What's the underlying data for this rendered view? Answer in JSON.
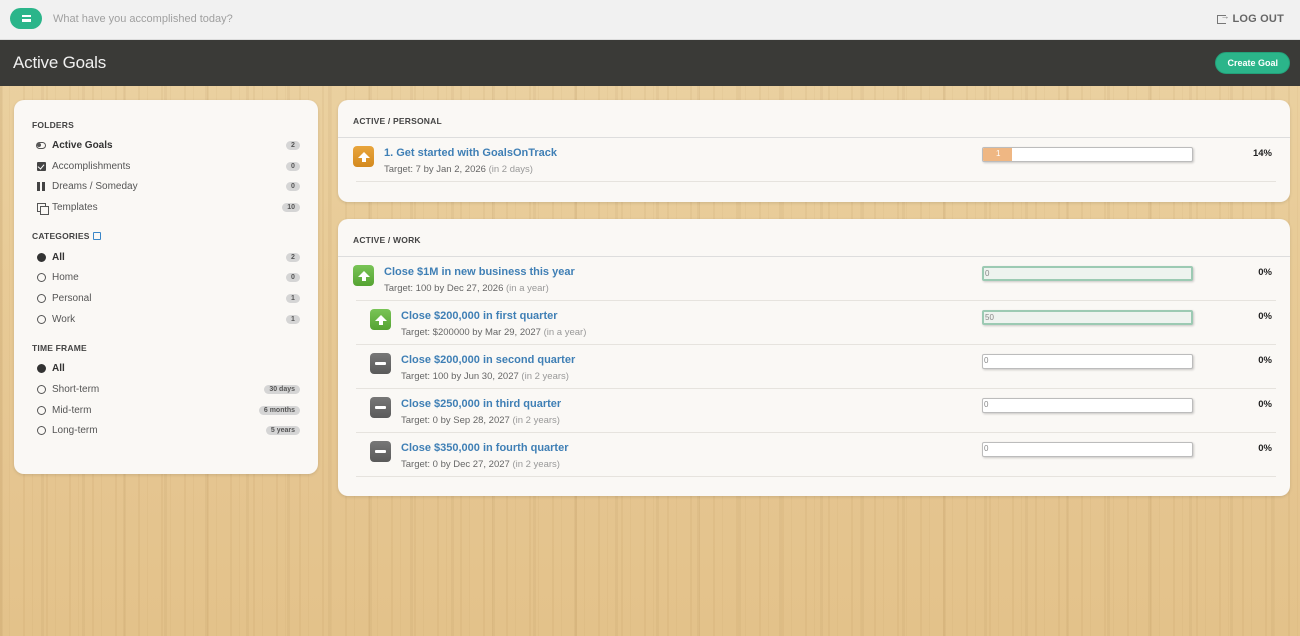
{
  "topbar": {
    "prompt": "What have you accomplished today?",
    "logout_label": "LOG OUT"
  },
  "header": {
    "title": "Active Goals",
    "create_label": "Create Goal"
  },
  "sidebar": {
    "folders_title": "FOLDERS",
    "folders": [
      {
        "label": "Active Goals",
        "count": "2",
        "icon": "toggle-icon"
      },
      {
        "label": "Accomplishments",
        "count": "0",
        "icon": "checkbox-icon"
      },
      {
        "label": "Dreams / Someday",
        "count": "0",
        "icon": "pause-icon"
      },
      {
        "label": "Templates",
        "count": "10",
        "icon": "templates-icon"
      }
    ],
    "categories_title": "CATEGORIES",
    "categories": [
      {
        "label": "All",
        "count": "2"
      },
      {
        "label": "Home",
        "count": "0"
      },
      {
        "label": "Personal",
        "count": "1"
      },
      {
        "label": "Work",
        "count": "1"
      }
    ],
    "timeframe_title": "TIME FRAME",
    "timeframes": [
      {
        "label": "All",
        "count": ""
      },
      {
        "label": "Short-term",
        "count": "30 days"
      },
      {
        "label": "Mid-term",
        "count": "6 months"
      },
      {
        "label": "Long-term",
        "count": "5 years"
      }
    ]
  },
  "personal": {
    "heading": "ACTIVE / PERSONAL",
    "goals": [
      {
        "title": "1. Get started with GoalsOnTrack",
        "target": "Target: 7 by Jan 2, 2026",
        "relative": "(in 2 days)",
        "value": "1",
        "percent": "14%",
        "progress": 0.14,
        "icon": "up-arrow-icon",
        "color": "#e09a2e"
      }
    ]
  },
  "work": {
    "heading": "ACTIVE / WORK",
    "goals": [
      {
        "title": "Close $1M in new business this year",
        "target": "Target: 100 by Dec 27, 2026",
        "relative": "(in a year)",
        "value": "0",
        "percent": "0%",
        "progress": 0,
        "icon": "up-arrow-icon",
        "color": "#68b545"
      },
      {
        "title": "Close $200,000 in first quarter",
        "target": "Target: $200000 by Mar 29, 2027",
        "relative": "(in a year)",
        "value": "50",
        "percent": "0%",
        "progress": 0,
        "icon": "up-arrow-icon",
        "color": "#68b545"
      },
      {
        "title": "Close $200,000 in second quarter",
        "target": "Target: 100 by Jun 30, 2027",
        "relative": "(in 2 years)",
        "value": "0",
        "percent": "0%",
        "progress": 0,
        "icon": "minus-icon",
        "color": "#666666"
      },
      {
        "title": "Close $250,000 in third quarter",
        "target": "Target: 0 by Sep 28, 2027",
        "relative": "(in 2 years)",
        "value": "0",
        "percent": "0%",
        "progress": 0,
        "icon": "minus-icon",
        "color": "#666666"
      },
      {
        "title": "Close $350,000 in fourth quarter",
        "target": "Target: 0 by Dec 27, 2027",
        "relative": "(in 2 years)",
        "value": "0",
        "percent": "0%",
        "progress": 0,
        "icon": "minus-icon",
        "color": "#666666"
      }
    ]
  },
  "colors": {
    "accent": "#2bb58a",
    "header_bg": "#3a3a37",
    "link": "#3f7fb5",
    "progress_fill": "#efb783"
  }
}
